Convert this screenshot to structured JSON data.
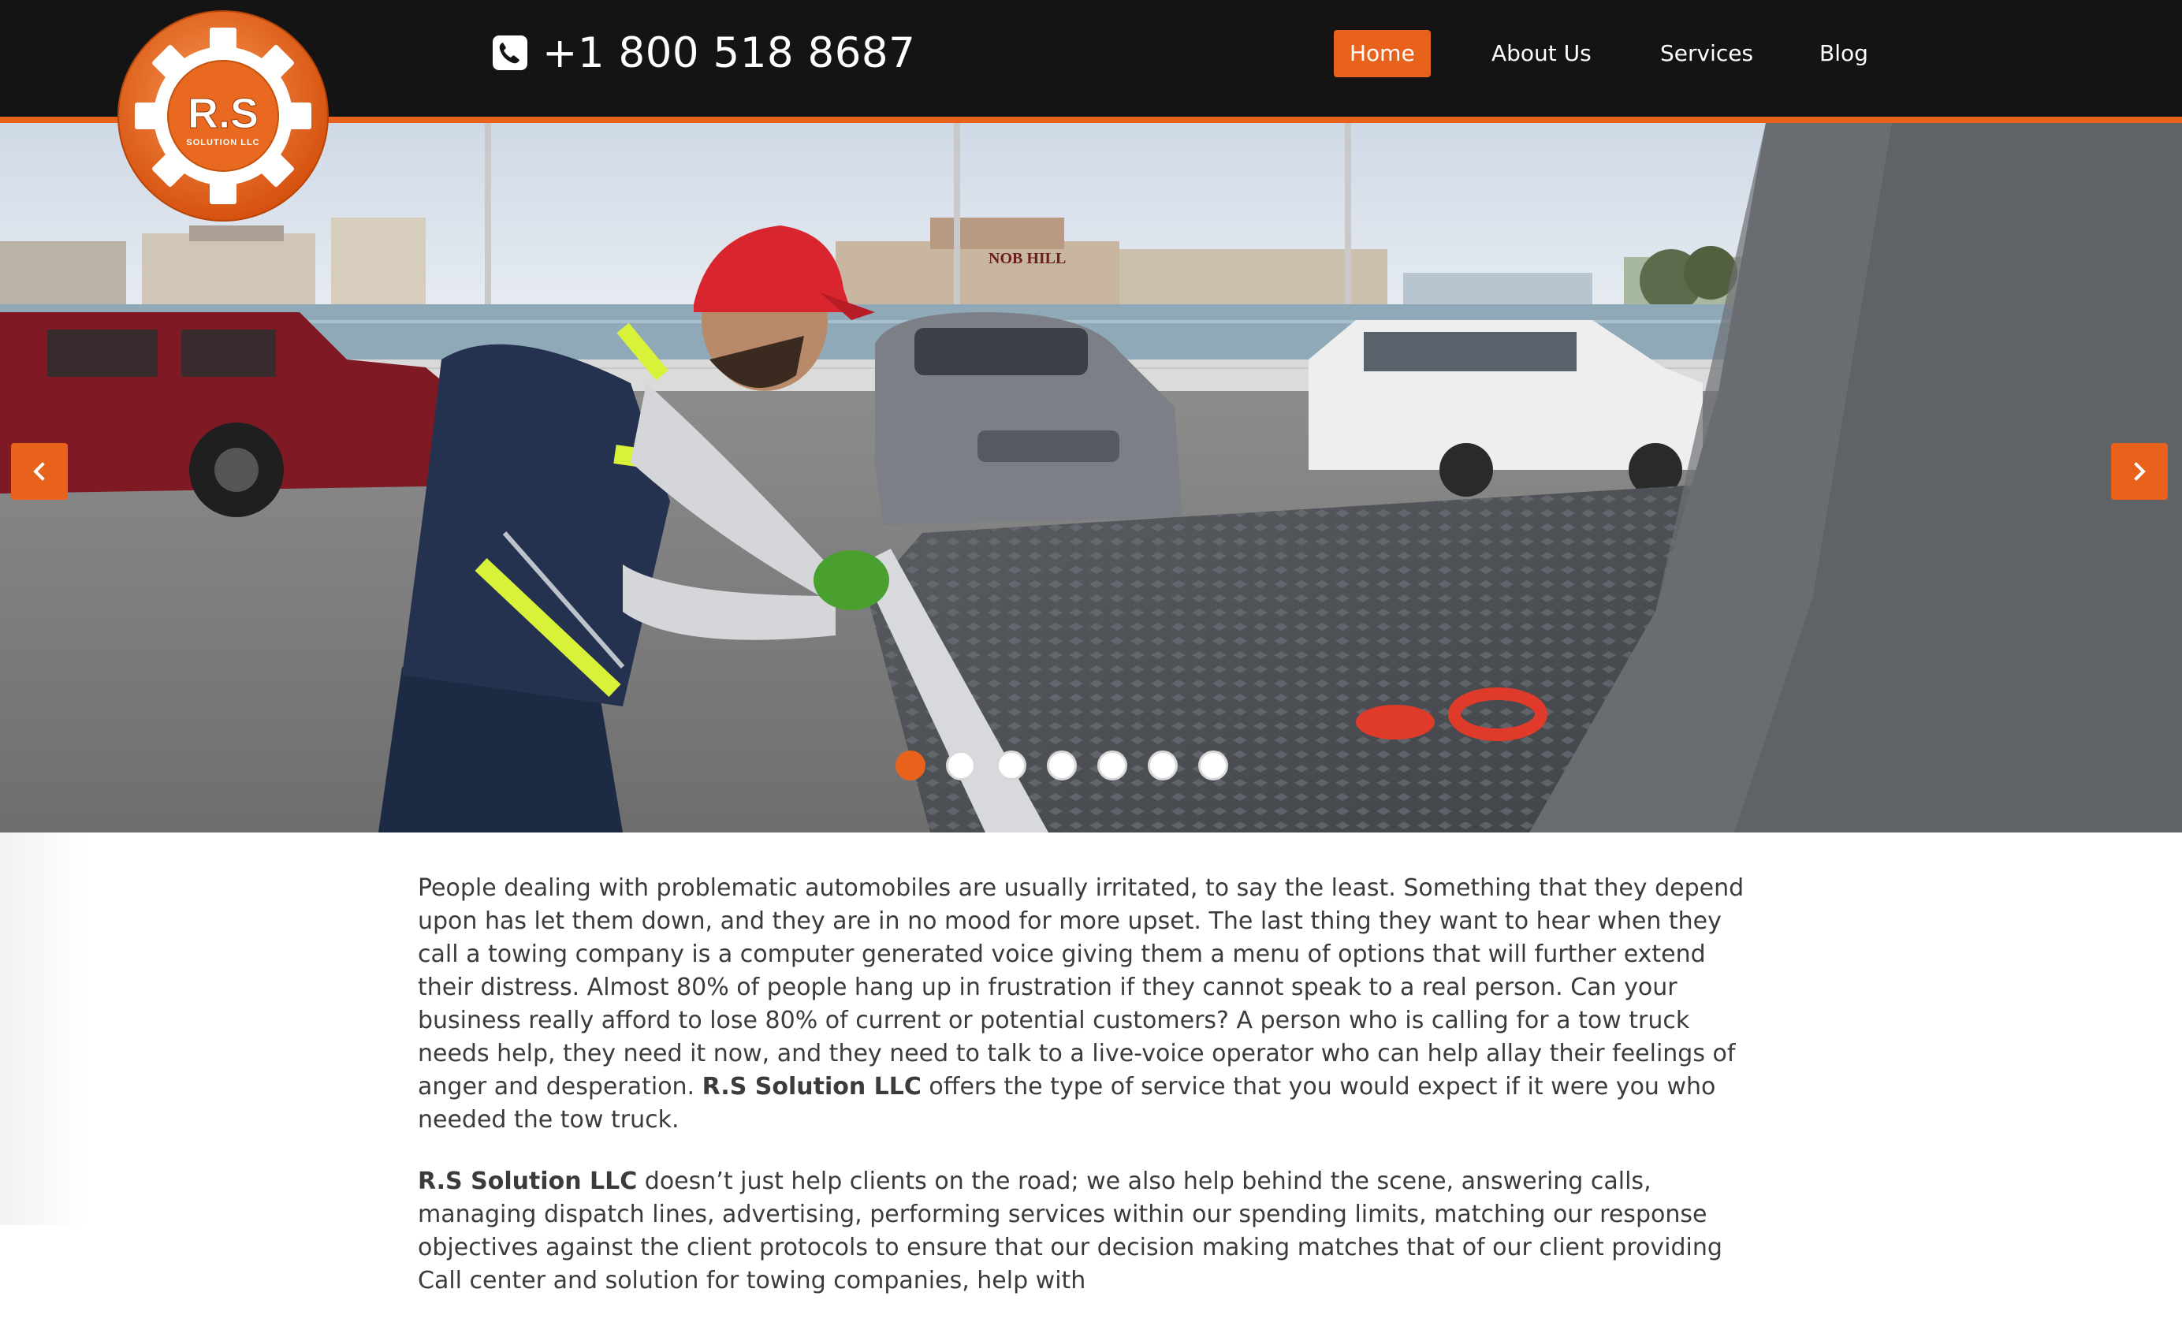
{
  "header": {
    "logo_text_main": "R.S",
    "logo_text_sub": "SOLUTION LLC",
    "phone_number": "+1 800 518 8687",
    "nav": [
      {
        "label": "Home",
        "active": true
      },
      {
        "label": "About Us",
        "active": false
      },
      {
        "label": "Services",
        "active": false
      },
      {
        "label": "Blog",
        "active": false
      }
    ]
  },
  "hero": {
    "sign_text": "NOB HILL",
    "prev_icon": "chevron-left-icon",
    "next_icon": "chevron-right-icon",
    "slide_count": 7,
    "active_slide": 1
  },
  "content": {
    "p1_a": "People dealing with problematic automobiles are usually irritated, to say the least. Something that they depend upon has let them down, and they are in no mood for more upset. The last thing they want to hear when they call a towing company is a computer generated voice giving them a menu of options that will further extend their distress. Almost 80% of people hang up in frustration if they cannot speak to a real person. Can your business really afford to lose 80% of current or potential customers? A person who is calling for a tow truck needs help, they need it now, and they need to talk to a live-voice operator who can help allay their feelings of anger and desperation. ",
    "p1_brand": "R.S Solution LLC",
    "p1_b": " offers the type of service that you would expect if it were you who needed the tow truck.",
    "p2_brand": "R.S Solution LLC",
    "p2_a": " doesn’t just help clients on the road; we also help behind the scene, answering calls, managing dispatch lines, advertising, performing services within our spending limits, matching our response objectives against the client protocols to ensure that our decision making matches that of our client providing Call center and solution for towing companies, help with"
  },
  "colors": {
    "accent": "#e8621c",
    "header_bg": "#141414",
    "text": "#3b3b3b"
  }
}
